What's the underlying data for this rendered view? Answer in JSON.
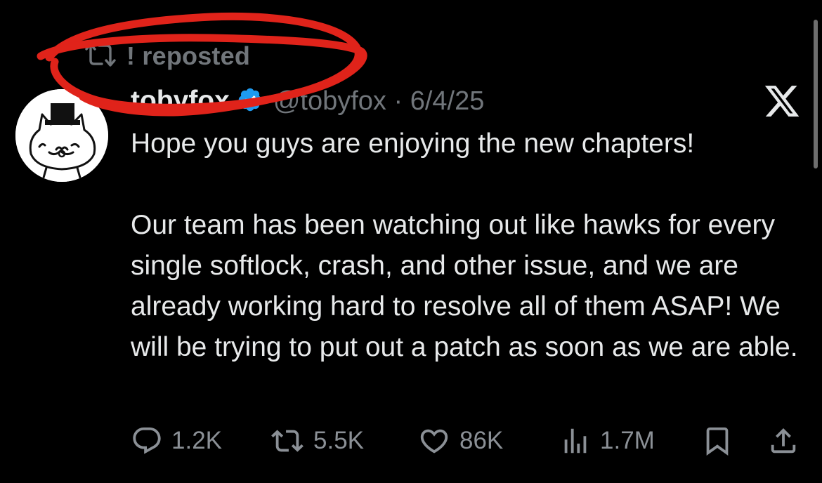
{
  "repost": {
    "icon": "repost-icon",
    "text": "! reposted"
  },
  "tweet": {
    "author_name": "tobyfox",
    "verified_icon": "verified-badge-icon",
    "handle_and_date": "@tobyfox · 6/4/25",
    "platform_icon": "x-logo-icon",
    "paragraphs": [
      "Hope you guys are enjoying the new chapters!",
      "Our team has been watching out like hawks for every single softlock, crash, and other issue, and we are already working hard to resolve all of them ASAP! We will be trying to put out a patch as soon as we are able."
    ]
  },
  "actions": {
    "replies": "1.2K",
    "reposts": "5.5K",
    "likes": "86K",
    "views": "1.7M"
  },
  "colors": {
    "background": "#000000",
    "text": "#e7e9ea",
    "muted": "#71767b",
    "verified": "#1d9bf0",
    "annotation": "#e0231a"
  }
}
